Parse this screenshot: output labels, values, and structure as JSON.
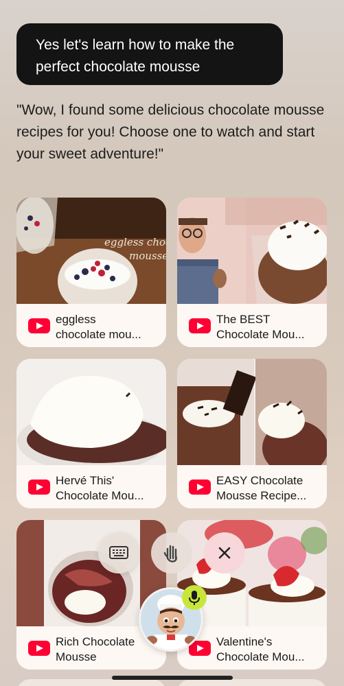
{
  "chat": {
    "user_message": "Yes let's learn how to make the perfect chocolate mousse",
    "assistant_message": "\"Wow, I found some delicious chocolate mousse recipes for you! Choose one to watch and start your sweet adventure!\""
  },
  "videos": [
    {
      "title_line1": "eggless",
      "title_line2": "chocolate mou...",
      "thumb_text_1": "eggless choco",
      "thumb_text_2": "mousse",
      "icon": "youtube-icon"
    },
    {
      "title_line1": "The BEST",
      "title_line2": "Chocolate Mou...",
      "icon": "youtube-icon"
    },
    {
      "title_line1": "Hervé This'",
      "title_line2": "Chocolate Mou...",
      "icon": "youtube-icon"
    },
    {
      "title_line1": "EASY Chocolate",
      "title_line2": "Mousse Recipe...",
      "icon": "youtube-icon"
    },
    {
      "title_line1": "Rich Chocolate",
      "title_line2": "Mousse",
      "icon": "youtube-icon"
    },
    {
      "title_line1": "Valentine's",
      "title_line2": "Chocolate Mou...",
      "icon": "youtube-icon"
    }
  ],
  "controls": {
    "keyboard_icon": "keyboard-icon",
    "hand_icon": "hand-icon",
    "close_icon": "close-icon",
    "mic_icon": "microphone-icon",
    "avatar": "chef-avatar"
  },
  "colors": {
    "youtube_red": "#ff0033",
    "bubble_bg": "#141414",
    "mic_green": "#c8e63a",
    "close_bg": "#f7d7d9"
  }
}
